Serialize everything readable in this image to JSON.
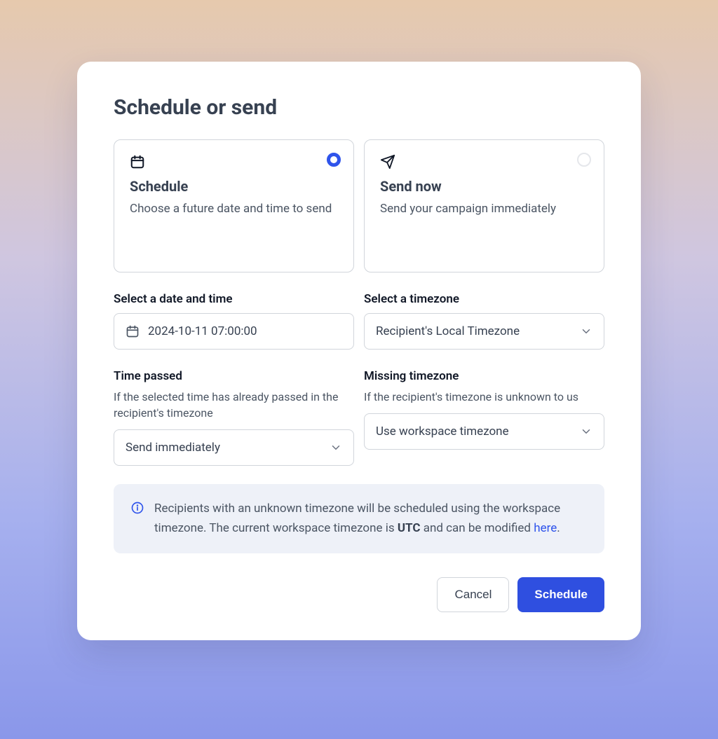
{
  "title": "Schedule or send",
  "options": {
    "schedule": {
      "title": "Schedule",
      "desc": "Choose a future date and time to send",
      "selected": true
    },
    "send_now": {
      "title": "Send now",
      "desc": "Send your campaign immediately",
      "selected": false
    }
  },
  "fields": {
    "datetime": {
      "label": "Select a date and time",
      "value": "2024-10-11 07:00:00"
    },
    "timezone": {
      "label": "Select a timezone",
      "value": "Recipient's Local Timezone"
    },
    "time_passed": {
      "label": "Time passed",
      "help": "If the selected time has already passed in the recipient's timezone",
      "value": "Send immediately"
    },
    "missing_tz": {
      "label": "Missing timezone",
      "help": "If the recipient's timezone is unknown to us",
      "value": "Use workspace timezone"
    }
  },
  "info": {
    "prefix": "Recipients with an unknown timezone will be scheduled using the workspace timezone. The current workspace timezone is ",
    "tz": "UTC",
    "middle": " and can be modified ",
    "link": "here",
    "suffix": "."
  },
  "buttons": {
    "cancel": "Cancel",
    "schedule": "Schedule"
  }
}
